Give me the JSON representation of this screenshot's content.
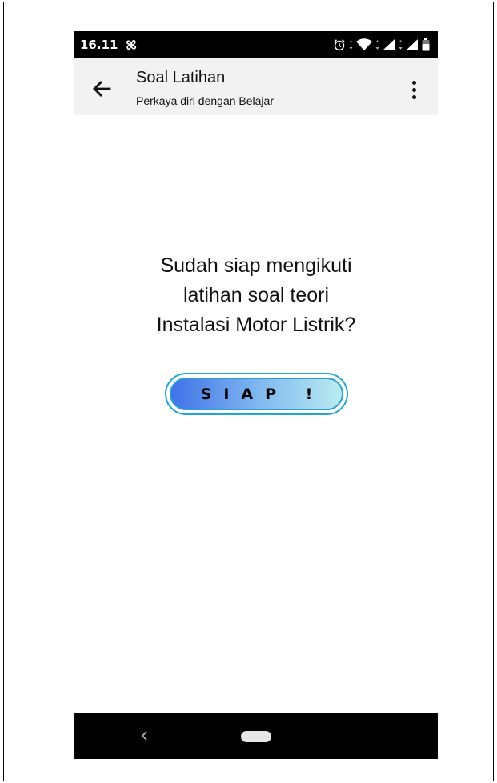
{
  "status_bar": {
    "time": "16.11",
    "icons": [
      "pinwheel-icon",
      "alarm-icon",
      "wifi-icon",
      "signal-icon",
      "signal-icon",
      "battery-icon"
    ]
  },
  "app_bar": {
    "title": "Soal Latihan",
    "subtitle": "Perkaya diri dengan Belajar",
    "icons": [
      "back-arrow-icon",
      "more-vert-icon"
    ]
  },
  "main": {
    "question_lines": [
      "Sudah siap mengikuti",
      "latihan soal teori",
      "Instalasi Motor Listrik?"
    ],
    "ready_button_label": "SIAP !"
  },
  "nav_bar": {
    "icons": [
      "nav-back-icon",
      "home-pill-icon"
    ]
  },
  "colors": {
    "button_gradient_start": "#3f72e8",
    "button_gradient_end": "#b9ecf0",
    "button_border": "#1ea6d6",
    "app_bar_background": "#f2f2f2"
  }
}
